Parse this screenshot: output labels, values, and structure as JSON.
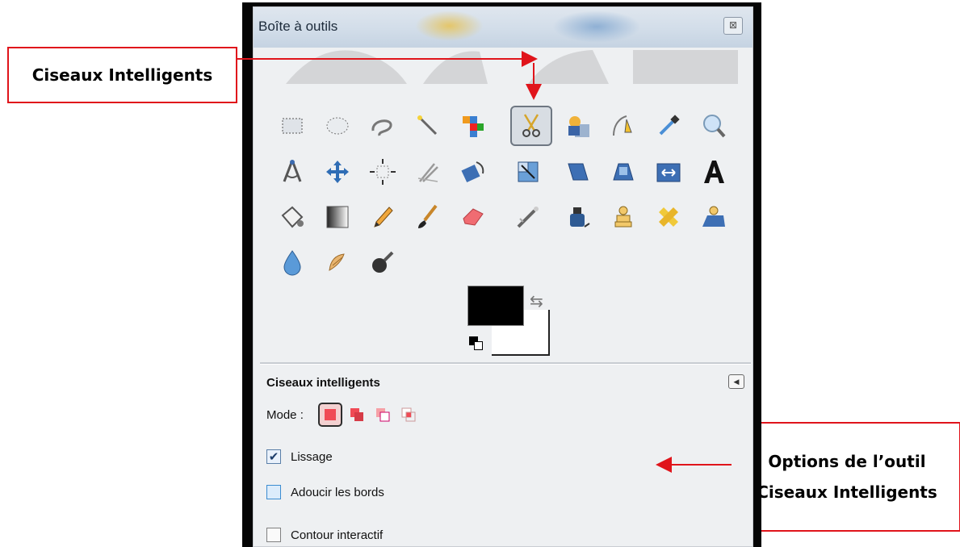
{
  "window": {
    "title": "Boîte à outils",
    "close_icon": "close-icon"
  },
  "callouts": {
    "left": {
      "text": "Ciseaux Intelligents"
    },
    "right": {
      "line1": "Options de l’outil",
      "line2": "Ciseaux Intelligents"
    }
  },
  "tools": [
    "rect-select-icon",
    "ellipse-select-icon",
    "free-select-icon",
    "fuzzy-select-icon",
    "color-select-icon",
    "scissors-select-icon",
    "foreground-select-icon",
    "paths-icon",
    "color-picker-icon",
    "zoom-icon",
    "measure-icon",
    "move-icon",
    "align-icon",
    "crop-icon",
    "rotate-icon",
    "scale-icon",
    "shear-icon",
    "perspective-icon",
    "flip-icon",
    "text-icon",
    "bucket-fill-icon",
    "blend-icon",
    "pencil-icon",
    "paintbrush-icon",
    "eraser-icon",
    "airbrush-icon",
    "ink-icon",
    "clone-icon",
    "heal-icon",
    "perspective-clone-icon",
    "blur-sharpen-icon",
    "smudge-icon",
    "dodge-burn-icon"
  ],
  "selected_tool": "scissors-select-icon",
  "colors": {
    "foreground": "#000000",
    "background": "#ffffff"
  },
  "options": {
    "title": "Ciseaux intelligents",
    "mode_label": "Mode :",
    "checkboxes": [
      {
        "label": "Lissage",
        "checked": true
      },
      {
        "label": "Adoucir les bords",
        "checked": false
      },
      {
        "label": "Contour interactif",
        "checked": false
      }
    ]
  },
  "accent": "#e0141b"
}
